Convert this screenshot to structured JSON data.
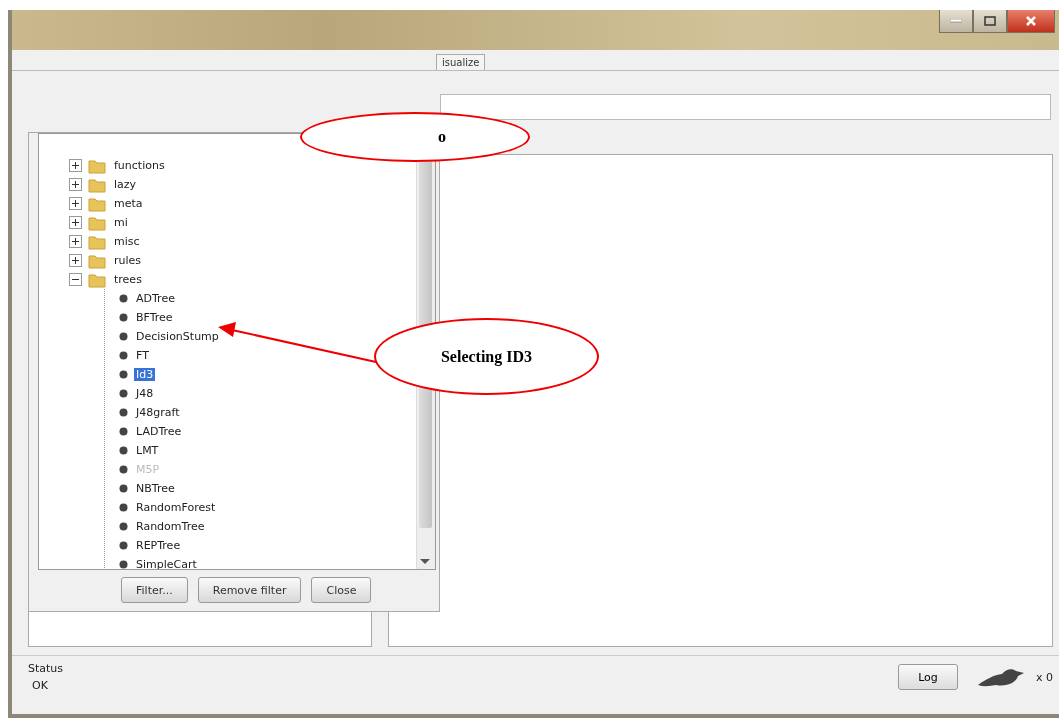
{
  "window": {
    "tabs": [
      {
        "label": "isualize",
        "selected": false
      }
    ]
  },
  "tree_chooser": {
    "folders": [
      {
        "label": "functions",
        "expanded": false
      },
      {
        "label": "lazy",
        "expanded": false
      },
      {
        "label": "meta",
        "expanded": false
      },
      {
        "label": "mi",
        "expanded": false
      },
      {
        "label": "misc",
        "expanded": false
      },
      {
        "label": "rules",
        "expanded": false
      },
      {
        "label": "trees",
        "expanded": true,
        "children": [
          {
            "label": "ADTree",
            "selected": false,
            "disabled": false
          },
          {
            "label": "BFTree",
            "selected": false,
            "disabled": false
          },
          {
            "label": "DecisionStump",
            "selected": false,
            "disabled": false
          },
          {
            "label": "FT",
            "selected": false,
            "disabled": false
          },
          {
            "label": "Id3",
            "selected": true,
            "disabled": false
          },
          {
            "label": "J48",
            "selected": false,
            "disabled": false
          },
          {
            "label": "J48graft",
            "selected": false,
            "disabled": false
          },
          {
            "label": "LADTree",
            "selected": false,
            "disabled": false
          },
          {
            "label": "LMT",
            "selected": false,
            "disabled": false
          },
          {
            "label": "M5P",
            "selected": false,
            "disabled": true
          },
          {
            "label": "NBTree",
            "selected": false,
            "disabled": false
          },
          {
            "label": "RandomForest",
            "selected": false,
            "disabled": false
          },
          {
            "label": "RandomTree",
            "selected": false,
            "disabled": false
          },
          {
            "label": "REPTree",
            "selected": false,
            "disabled": false
          },
          {
            "label": "SimpleCart",
            "selected": false,
            "disabled": false
          }
        ]
      }
    ],
    "buttons": [
      "Filter...",
      "Remove filter",
      "Close"
    ]
  },
  "status": {
    "label": "Status",
    "message": "OK",
    "log_button": "Log",
    "count": "x 0"
  },
  "callouts": [
    {
      "text": "o"
    },
    {
      "text": "Selecting ID3"
    }
  ]
}
